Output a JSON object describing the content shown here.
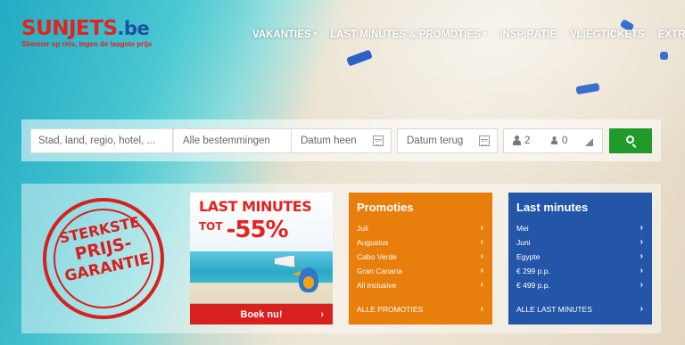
{
  "brand": {
    "name": "SUNJETS",
    "tld": ".be",
    "tagline": "Slimmer op reis, tegen de laagste prijs",
    "colors": {
      "red": "#e3231e",
      "blue": "#1e4fa3"
    }
  },
  "nav": [
    {
      "label": "VAKANTIES",
      "dropdown": true
    },
    {
      "label": "LAST MINUTES & PROMOTIES",
      "dropdown": true
    },
    {
      "label": "INSPIRATIE",
      "dropdown": false
    },
    {
      "label": "VLIEGTICKETS",
      "dropdown": false
    },
    {
      "label": "EXTRA'S",
      "dropdown": false
    }
  ],
  "nav_caret": "▾",
  "search": {
    "destination_placeholder": "Stad, land, regio, hotel, ...",
    "region_value": "Alle bestemmingen",
    "date_from_placeholder": "Datum heen",
    "date_to_placeholder": "Datum terug",
    "adults": "2",
    "children": "0",
    "button_icon": "search-icon",
    "button_color": "#1f9a2b"
  },
  "guarantee_stamp": {
    "line1": "STERKSTE",
    "line2": "PRIJS-",
    "line3": "GARANTIE",
    "color": "#d8201f"
  },
  "promo_ad": {
    "title": "LAST MINUTES",
    "prefix": "TOT",
    "discount": "-55%",
    "button_label": "Boek nu!",
    "chevron": "›"
  },
  "promoties": {
    "title": "Promoties",
    "color": "#e87e0c",
    "items": [
      "Juli",
      "Augustus",
      "Cabo Verde",
      "Gran Canaria",
      "All inclusive"
    ],
    "all_label": "ALLE PROMOTIES"
  },
  "last_minutes": {
    "title": "Last minutes",
    "color": "#2355a8",
    "items": [
      "Mei",
      "Juni",
      "Egypte",
      "€ 299 p.p.",
      "€ 499 p.p."
    ],
    "all_label": "ALLE LAST MINUTES"
  },
  "chevron": "›"
}
